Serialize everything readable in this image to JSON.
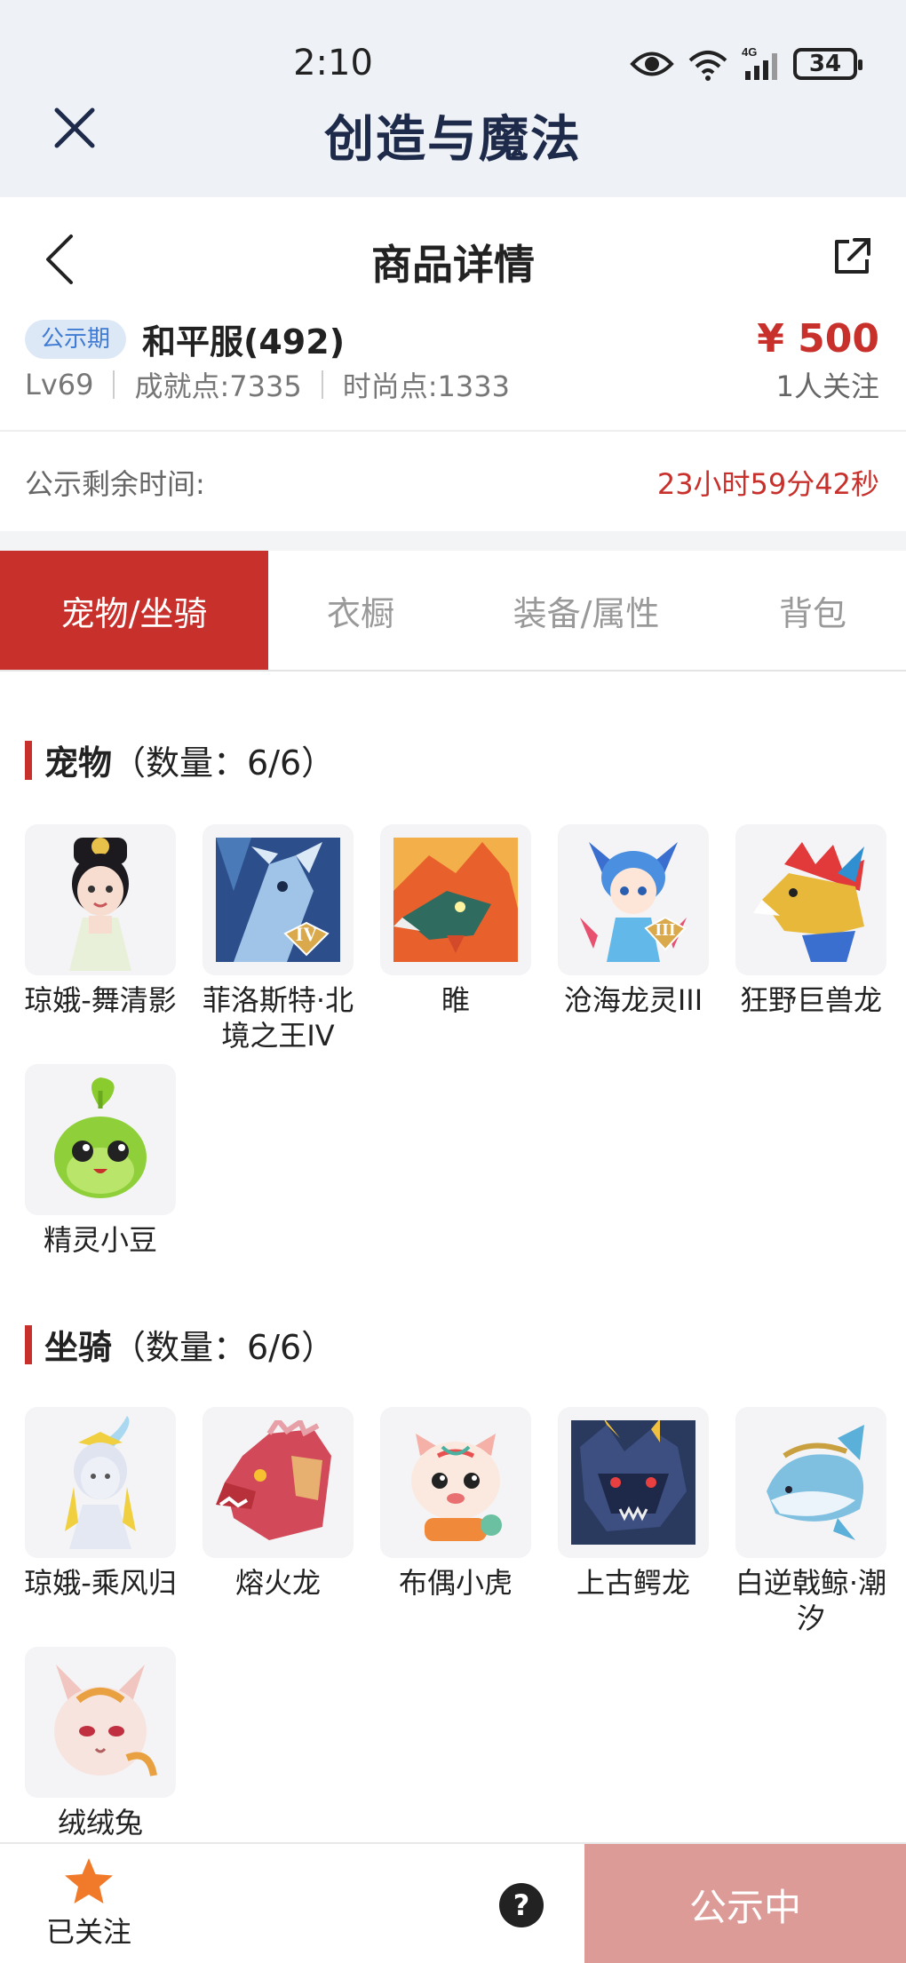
{
  "status_bar": {
    "time": "2:10",
    "battery": "34",
    "network": "4G"
  },
  "app": {
    "title": "创造与魔法"
  },
  "nav": {
    "title": "商品详情"
  },
  "listing": {
    "badge": "公示期",
    "server": "和平服(492)",
    "price": "¥ 500",
    "level": "Lv69",
    "achievement": "成就点:7335",
    "fashion": "时尚点:1333",
    "followers": "1人关注"
  },
  "countdown": {
    "label": "公示剩余时间:",
    "value": "23小时59分42秒"
  },
  "tabs": [
    {
      "label": "宠物/坐骑",
      "active": true
    },
    {
      "label": "衣橱",
      "active": false
    },
    {
      "label": "装备/属性",
      "active": false
    },
    {
      "label": "背包",
      "active": false
    }
  ],
  "pets": {
    "title": "宠物",
    "count": "（数量：6/6）",
    "items": [
      {
        "name": "琼娥-舞清影",
        "icon": "fairy-pet-icon"
      },
      {
        "name": "菲洛斯特·北境之王IV",
        "icon": "frost-dragon-icon",
        "tier": "IV"
      },
      {
        "name": "睢",
        "icon": "fire-beast-icon"
      },
      {
        "name": "沧海龙灵III",
        "icon": "sea-dragon-spirit-icon",
        "tier": "III"
      },
      {
        "name": "狂野巨兽龙",
        "icon": "wild-dragon-icon"
      },
      {
        "name": "精灵小豆",
        "icon": "green-sprout-pet-icon"
      }
    ]
  },
  "mounts": {
    "title": "坐骑",
    "count": "（数量：6/6）",
    "items": [
      {
        "name": "琼娥-乘风归",
        "icon": "fairy-mount-icon"
      },
      {
        "name": "熔火龙",
        "icon": "lava-dragon-icon"
      },
      {
        "name": "布偶小虎",
        "icon": "toy-tiger-icon"
      },
      {
        "name": "上古鳄龙",
        "icon": "ancient-croc-dragon-icon"
      },
      {
        "name": "白逆戟鲸·潮汐",
        "icon": "white-orca-icon"
      },
      {
        "name": "绒绒兔",
        "icon": "fluffy-rabbit-icon"
      }
    ]
  },
  "bottom": {
    "follow_label": "已关注",
    "help": "?",
    "status_button": "公示中"
  },
  "colors": {
    "accent": "#c8302c",
    "badge_bg": "#dde8f7",
    "badge_text": "#3f7bd3",
    "status_button_bg": "#dd9b98"
  }
}
